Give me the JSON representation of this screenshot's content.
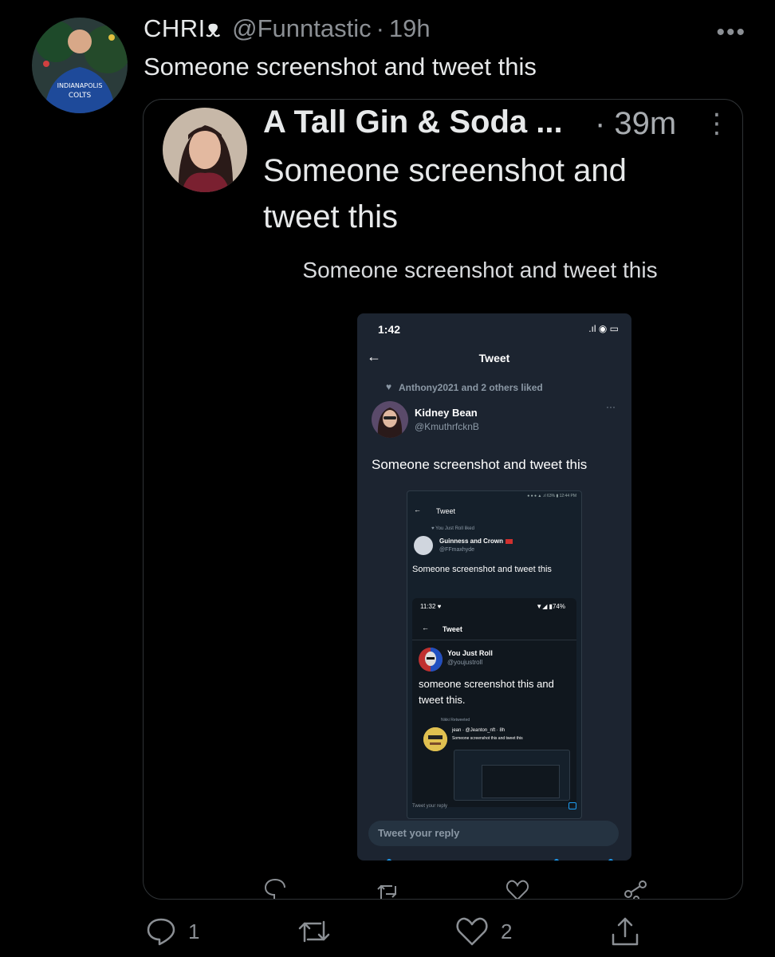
{
  "tweet": {
    "display_name": "CHRIᴥ",
    "handle": "@Funntastic",
    "separator": "·",
    "time": "19h",
    "more": "•••",
    "text": "Someone screenshot and tweet this",
    "stats": {
      "replies": "1",
      "likes": "2"
    }
  },
  "quoted": {
    "display_name": "A Tall Gin & Soda ...",
    "time": "· 39m",
    "more": "⋮",
    "text": "Someone screenshot and tweet this",
    "caption": "Someone screenshot and tweet this",
    "phone": {
      "status_time": "1:42",
      "status_icons": ".ıl ◉ ▭",
      "back": "←",
      "title": "Tweet",
      "liked_line": "Anthony2021 and 2 others liked",
      "name": "Kidney Bean",
      "handle": "@KmuthrfcknB",
      "more": "···",
      "text": "Someone screenshot and tweet this",
      "reply_placeholder": "Tweet your reply",
      "nested": {
        "status": "● ● ● ▲ .ıl 63% ▮ 12:44 PM",
        "back": "←",
        "title": "Tweet",
        "liked_line": "♥ You Just Roll liked",
        "name": "Guinness and Crown",
        "handle": "@FFmaxhyde",
        "text": "Someone screenshot and tweet this",
        "reply_placeholder": "Tweet your reply",
        "inner": {
          "status_time": "11:32 ♥",
          "status_right": "▼◢ ▮74%",
          "back": "←",
          "title": "Tweet",
          "name": "You Just Roll",
          "handle": "@youjustroll",
          "text": "someone screenshot this and tweet this.",
          "retweeted": "Nikki Retweeted",
          "jean_name": "jean · @Jeanton_nft · 8h",
          "jean_text": "Someone screenshot this and tweet this"
        }
      }
    }
  },
  "colors": {
    "background": "#000000",
    "secondary_text": "#8b8f94",
    "border": "#2f3336",
    "phone_bg": "#1c2430",
    "accent": "#1d9bf0"
  },
  "icons": [
    "reply-icon",
    "retweet-icon",
    "like-icon",
    "share-icon",
    "more-icon"
  ]
}
